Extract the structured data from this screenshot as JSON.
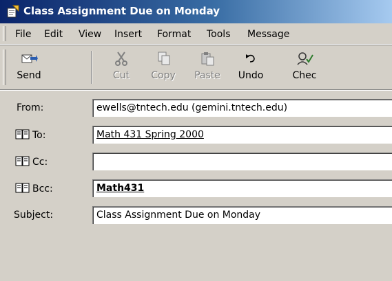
{
  "window": {
    "title": "Class Assignment Due on Monday"
  },
  "menu": [
    "File",
    "Edit",
    "View",
    "Insert",
    "Format",
    "Tools",
    "Message"
  ],
  "toolbar": {
    "send": "Send",
    "cut": "Cut",
    "copy": "Copy",
    "paste": "Paste",
    "undo": "Undo",
    "check": "Chec"
  },
  "headers": {
    "from_label": "From:",
    "from_value": "ewells@tntech.edu    (gemini.tntech.edu)",
    "to_label": "To:",
    "to_value": "Math 431 Spring 2000",
    "cc_label": "Cc:",
    "cc_value": "",
    "bcc_label": "Bcc:",
    "bcc_value": "Math431",
    "subject_label": "Subject:",
    "subject_value": "Class Assignment Due on Monday"
  },
  "colors": {
    "title_bar_start": "#0a246a",
    "title_bar_end": "#a6caf0",
    "chrome": "#d4d0c8"
  }
}
